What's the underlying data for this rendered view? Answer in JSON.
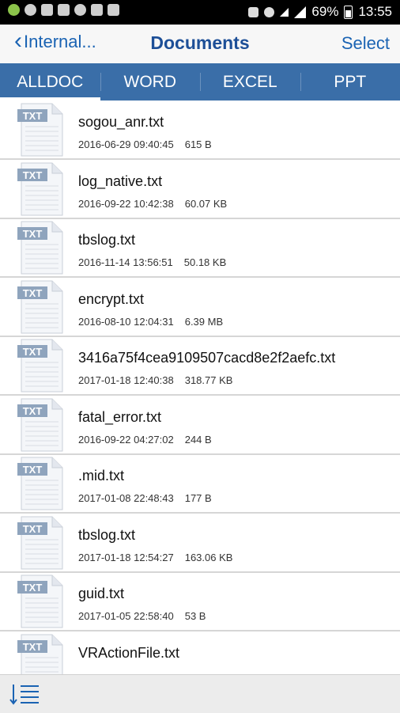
{
  "status": {
    "battery": "69%",
    "time": "13:55"
  },
  "header": {
    "back_label": "Internal...",
    "title": "Documents",
    "select_label": "Select"
  },
  "tabs": [
    {
      "label": "ALLDOC",
      "active": true
    },
    {
      "label": "WORD",
      "active": false
    },
    {
      "label": "EXCEL",
      "active": false
    },
    {
      "label": "PPT",
      "active": false
    }
  ],
  "file_icon_label": "TXT",
  "files": [
    {
      "name": "sogou_anr.txt",
      "date": "2016-06-29 09:40:45",
      "size": "615 B"
    },
    {
      "name": "log_native.txt",
      "date": "2016-09-22 10:42:38",
      "size": "60.07 KB"
    },
    {
      "name": "tbslog.txt",
      "date": "2016-11-14 13:56:51",
      "size": "50.18 KB"
    },
    {
      "name": "encrypt.txt",
      "date": "2016-08-10 12:04:31",
      "size": "6.39 MB"
    },
    {
      "name": "3416a75f4cea9109507cacd8e2f2aefc.txt",
      "date": "2017-01-18 12:40:38",
      "size": "318.77 KB"
    },
    {
      "name": "fatal_error.txt",
      "date": "2016-09-22 04:27:02",
      "size": "244 B"
    },
    {
      "name": ".mid.txt",
      "date": "2017-01-08 22:48:43",
      "size": "177 B"
    },
    {
      "name": "tbslog.txt",
      "date": "2017-01-18 12:54:27",
      "size": "163.06 KB"
    },
    {
      "name": "guid.txt",
      "date": "2017-01-05 22:58:40",
      "size": "53 B"
    },
    {
      "name": "VRActionFile.txt",
      "date": "",
      "size": ""
    }
  ],
  "colors": {
    "accent": "#3a6ea8",
    "title": "#1d4f97",
    "link": "#1a63b3"
  }
}
